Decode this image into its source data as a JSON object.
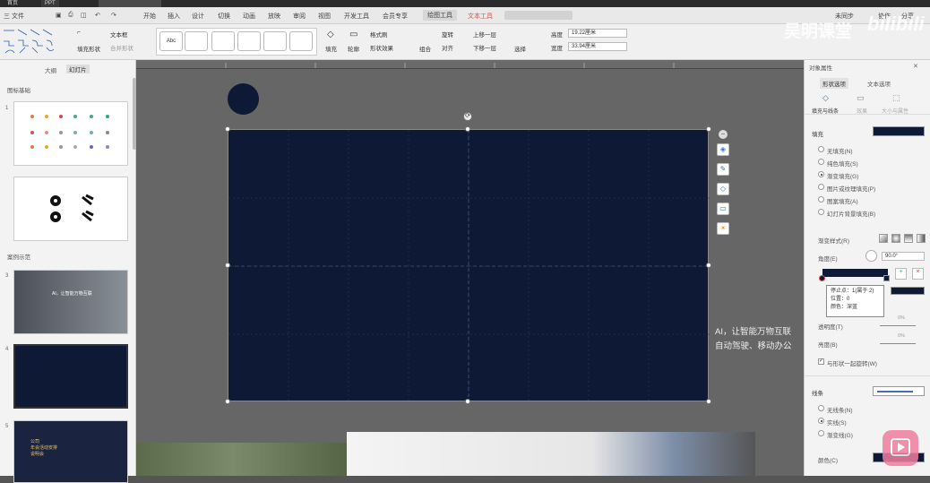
{
  "titlebar": {
    "tab1": "首页",
    "tab2": "PPT"
  },
  "menu": {
    "file": "三 文件",
    "items": [
      "开始",
      "插入",
      "设计",
      "切换",
      "动画",
      "放映",
      "审阅",
      "视图",
      "开发工具",
      "会员专享"
    ],
    "drawing_tools": "绘图工具",
    "text_tools": "文本工具",
    "collab": "协作",
    "share": "分享",
    "sync": "未同步"
  },
  "ribbon": {
    "fill_fmt": "填充形状",
    "textbox": "文本框",
    "merge_shape": "合并形状",
    "style_labels": [
      "Abc",
      "Abc",
      "Abc",
      "Abc",
      "Abc",
      "Abc"
    ],
    "style_colors": [
      "#ffffff",
      "#000000",
      "#4a90d9",
      "#ed7d31",
      "#a5a5a5",
      "#ffc000"
    ],
    "fill": "填充",
    "outline": "轮廓",
    "effects": "形状效果",
    "format_brush": "格式刷",
    "group": "组合",
    "rotate": "旋转",
    "align": "对齐",
    "bring_forward": "上移一层",
    "send_backward": "下移一层",
    "select": "选择",
    "height_label": "高度",
    "height_value": "19.22厘米",
    "width_label": "宽度",
    "width_value": "33.94厘米"
  },
  "leftpanel": {
    "tab_outline": "大纲",
    "tab_slides": "幻灯片",
    "section1": "图标基础",
    "section2": "案例示范",
    "slide_numbers": [
      "1",
      "2",
      "3",
      "4",
      "5"
    ],
    "slide3_caption": "AI，让智能万物互联",
    "slide5_title": "公司\n年会活动安排\n说明会"
  },
  "slide": {
    "background": "#0e1a35",
    "side_text_line1": "AI，让智能万物互联",
    "side_text_line2": "自动驾驶、移动办公"
  },
  "rightpanel": {
    "title": "对象属性",
    "tab_shape": "形状选项",
    "tab_text": "文本选项",
    "subtab1": "填充与线条",
    "subtab2": "效果",
    "subtab3": "大小与属性",
    "fill_section": "填充",
    "fill_color": "#0e1a35",
    "fill_options": [
      "无填充(N)",
      "纯色填充(S)",
      "渐变填充(G)",
      "图片或纹理填充(P)",
      "图案填充(A)",
      "幻灯片背景填充(B)"
    ],
    "fill_selected": 2,
    "gradient_style": "渐变样式(R)",
    "angle_label": "角度(E)",
    "angle_value": "90.0°",
    "transparency_label": "透明度(T)",
    "transparency_value": "0%",
    "brightness_label": "亮度(B)",
    "brightness_value": "0%",
    "rotate_with_shape": "与形状一起旋转(W)",
    "line_section": "线条",
    "line_options": [
      "无线条(N)",
      "实线(S)",
      "渐变线(G)"
    ],
    "line_selected": 1,
    "color_label": "颜色(C)",
    "color_value": "#0e1a35"
  },
  "tooltip": {
    "line1": "停止点：1(属于 2)",
    "line2": "位置：0",
    "line3": "颜色：深蓝"
  },
  "watermark": {
    "text": "吴明课堂",
    "logo": "bilibili"
  }
}
